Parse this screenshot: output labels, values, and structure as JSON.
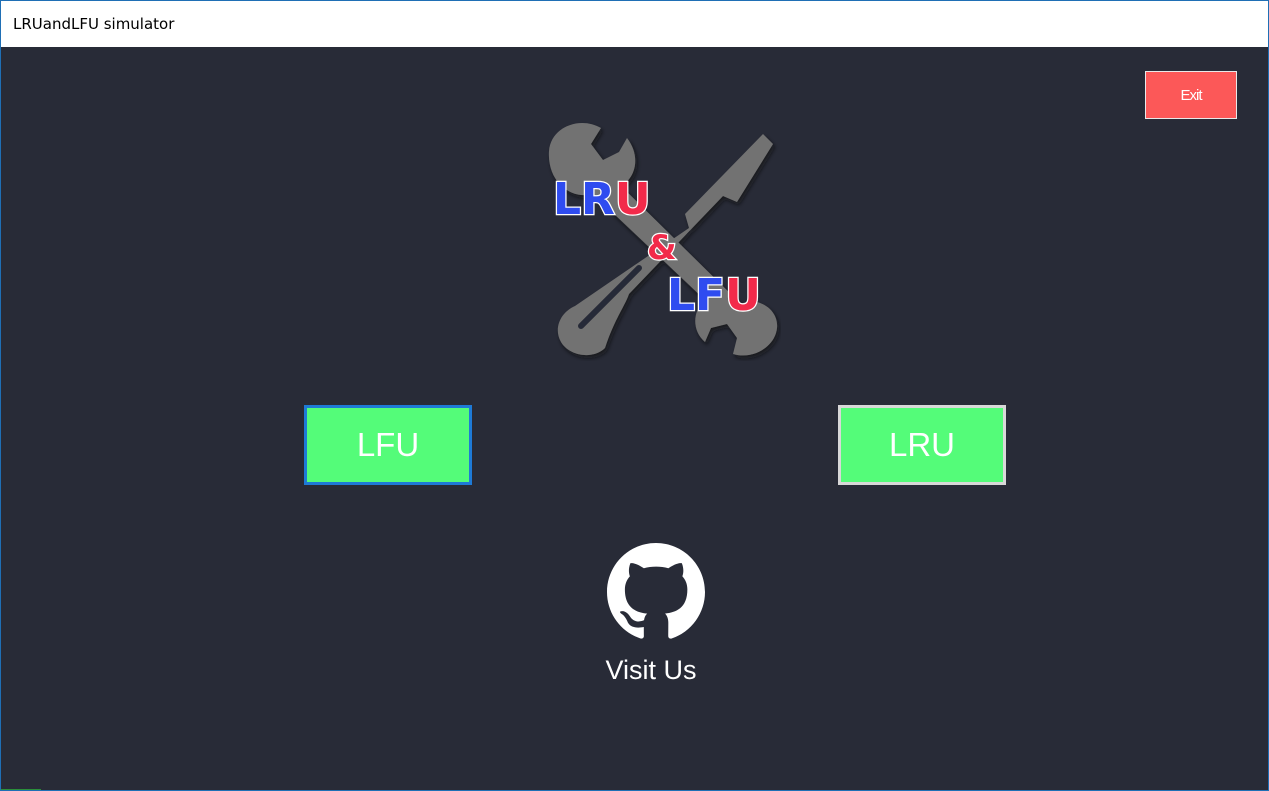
{
  "window": {
    "title": "LRUandLFU simulator"
  },
  "buttons": {
    "exit_label": "Exit",
    "lfu_label": "LFU",
    "lru_label": "LRU"
  },
  "logo": {
    "line1": "LRU",
    "amp": "&",
    "line2": "LFU",
    "icon": "wrench-screwdriver-icon"
  },
  "footer": {
    "github_icon": "github-icon",
    "visit_label": "Visit Us"
  },
  "colors": {
    "background": "#282b37",
    "exit": "#fc5858",
    "mode_button": "#54fc79",
    "logo_blue": "#2f4cf0",
    "logo_red": "#f22a4a"
  }
}
